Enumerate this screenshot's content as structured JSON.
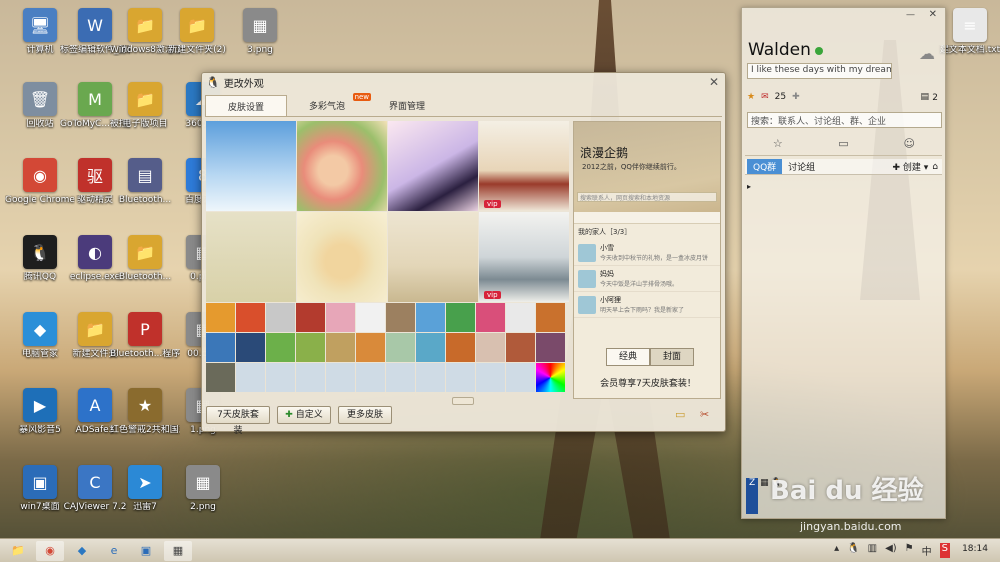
{
  "desktop_icons": [
    {
      "label": "计算机",
      "color": "#4a7fc2",
      "glyph": "🖥"
    },
    {
      "label": "标签编辑软件_源码（...",
      "color": "#3b6cb3",
      "glyph": "W"
    },
    {
      "label": "Windows8激活工具...",
      "color": "#d9a630",
      "glyph": "📁"
    },
    {
      "label": "新建文件夹(2)",
      "color": "#d9a630",
      "glyph": "📁"
    },
    {
      "label": "3.png",
      "color": "#8a8a8a",
      "glyph": "▦"
    },
    {
      "label": "回收站",
      "color": "#7e8ea0",
      "glyph": "🗑"
    },
    {
      "label": "GoToMyC...被控端",
      "color": "#6aa84f",
      "glyph": "M"
    },
    {
      "label": "电子版项目",
      "color": "#d9a630",
      "glyph": "📁"
    },
    {
      "label": "360云盘",
      "color": "#2b78c2",
      "glyph": "☁"
    },
    {
      "label": "Google Chrome",
      "color": "#d34836",
      "glyph": "◉"
    },
    {
      "label": "驱动精灵",
      "color": "#c0312b",
      "glyph": "驱"
    },
    {
      "label": "Bluetooth...",
      "color": "#555d8a",
      "glyph": "▤"
    },
    {
      "label": "百度云管",
      "color": "#2e7bd8",
      "glyph": "8"
    },
    {
      "label": "腾讯QQ",
      "color": "#1e1e1e",
      "glyph": "🐧"
    },
    {
      "label": "eclipse.exe",
      "color": "#4b3b7b",
      "glyph": "◐"
    },
    {
      "label": "Bluetooth...",
      "color": "#d9a630",
      "glyph": "📁"
    },
    {
      "label": "0.png",
      "color": "#8a8a8a",
      "glyph": "▦"
    },
    {
      "label": "电脑管家",
      "color": "#2b8fd8",
      "glyph": "◆"
    },
    {
      "label": "新建文件夹",
      "color": "#d9a630",
      "glyph": "📁"
    },
    {
      "label": "Bluetooth...程序说明.p...",
      "color": "#c0312b",
      "glyph": "P"
    },
    {
      "label": "00.png",
      "color": "#8a8a8a",
      "glyph": "▦"
    },
    {
      "label": "暴风影音5",
      "color": "#1e6fb8",
      "glyph": "▶"
    },
    {
      "label": "ADSafe3",
      "color": "#2d72c9",
      "glyph": "A"
    },
    {
      "label": "红色警戒2共和国之辉...",
      "color": "#8a6b2e",
      "glyph": "★"
    },
    {
      "label": "1.png",
      "color": "#8a8a8a",
      "glyph": "▦"
    },
    {
      "label": "win7桌面",
      "color": "#2b6cb8",
      "glyph": "▣"
    },
    {
      "label": "CAJViewer 7.2",
      "color": "#3b76c4",
      "glyph": "C"
    },
    {
      "label": "迅雷7",
      "color": "#2b89d6",
      "glyph": "➤"
    },
    {
      "label": "2.png",
      "color": "#8a8a8a",
      "glyph": "▦"
    },
    {
      "label": "建文本文档.txt",
      "color": "#e8e8e8",
      "glyph": "≡"
    }
  ],
  "skin_dialog": {
    "title": "更改外观",
    "tabs": [
      {
        "label": "皮肤设置"
      },
      {
        "label": "多彩气泡",
        "badge": "new"
      },
      {
        "label": "界面管理"
      }
    ],
    "vip_tag": "vip",
    "buttons": {
      "seven_day": "7天皮肤套装",
      "custom": "自定义",
      "more": "更多皮肤"
    },
    "preview": {
      "name": "浪漫企鹅",
      "signature": "2012之前，QQ伴你继续前行。",
      "search": "搜索联系人，网页搜索和本地资源",
      "group_label": "我的家人［3/3］",
      "contacts": [
        {
          "name": "小雪",
          "msg": "今天收到中秋节的礼物，是一盒冰皮月饼"
        },
        {
          "name": "妈妈",
          "msg": "今天中饭是洋山芋排骨汤哦。"
        },
        {
          "name": "小阿狸",
          "msg": "明天早上会下雨吗？我是新家了"
        }
      ],
      "seg_classic": "经典",
      "seg_cover": "封面",
      "promo": "会员尊享7天皮肤套装！"
    }
  },
  "qq_panel": {
    "username": "Walden",
    "signature": "I like these days with my dream.",
    "mail_count": "25",
    "msg_count": "2",
    "search_placeholder": "搜索：联系人、讨论组、群、企业",
    "tab_qqgroup": "QQ群",
    "tab_discussion": "讨论组",
    "create_label": "创建"
  },
  "watermark": {
    "text": "Bai du 经验",
    "url": "jingyan.baidu.com"
  },
  "taskbar": {
    "time": "18:14",
    "ime": "中",
    "lang_s": "S"
  }
}
